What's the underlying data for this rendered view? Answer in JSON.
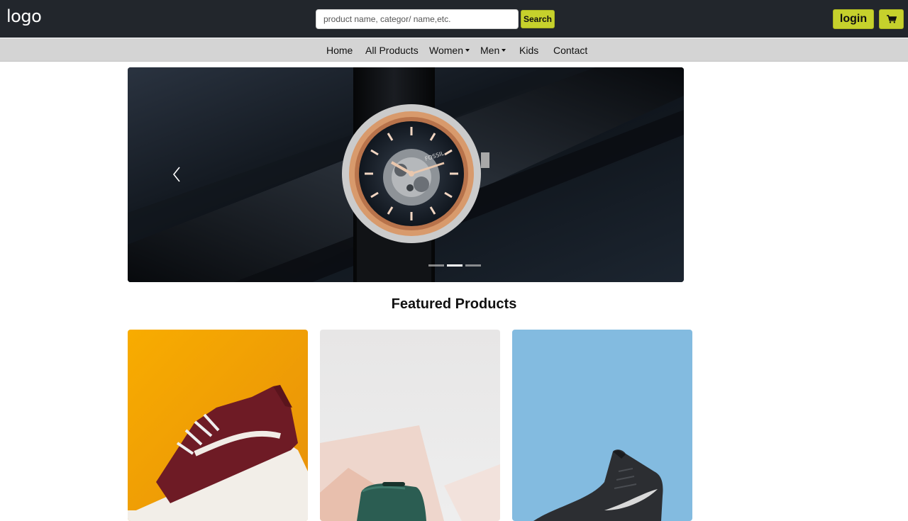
{
  "header": {
    "logo": "logo",
    "search": {
      "placeholder": "product name, categor/ name,etc.",
      "value": "",
      "button_label": "Search"
    },
    "login_label": "login",
    "cart_icon": "cart-icon"
  },
  "nav": {
    "items": [
      {
        "label": "Home"
      },
      {
        "label": "All Products"
      },
      {
        "label": "Women"
      },
      {
        "label": "Men"
      },
      {
        "label": "Kids"
      },
      {
        "label": "Contact"
      }
    ]
  },
  "carousel": {
    "watch_brand": "FOSSIL",
    "active_slide": 2,
    "slide_count": 3
  },
  "featured": {
    "title": "Featured Products"
  },
  "colors": {
    "header_bg": "#22262c",
    "nav_bg": "#d4d4d4",
    "accent": "#c6d12c",
    "card1_bg": "#f5a400",
    "card2_bg": "#e8e7e7",
    "card3_bg": "#83bbe0"
  }
}
